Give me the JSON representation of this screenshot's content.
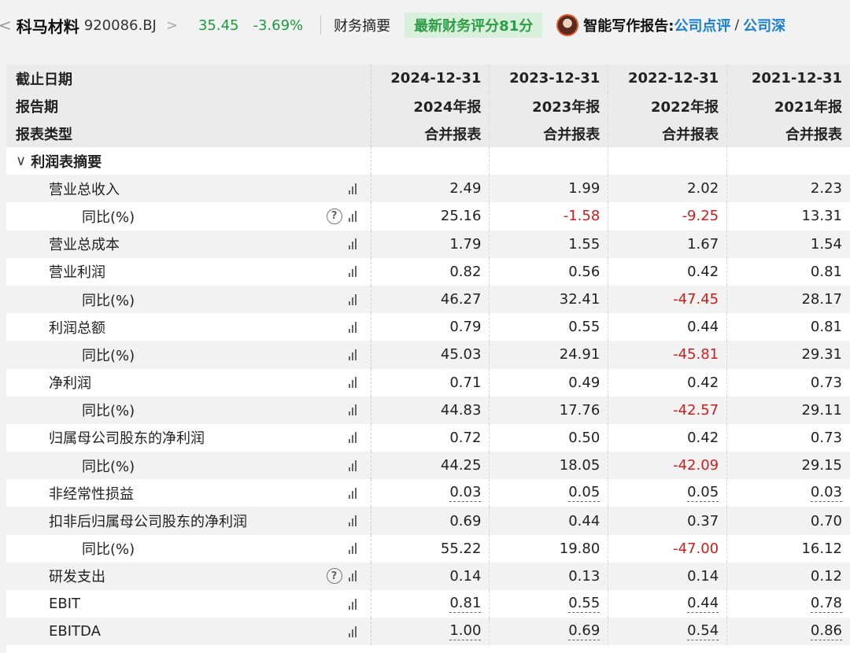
{
  "header": {
    "back_glyph": "<",
    "stock_name": "科马材料",
    "stock_code": "920086.BJ",
    "code_chevron": ">",
    "price": "35.45",
    "change_pct": "-3.69%",
    "section_label": "财务摘要",
    "score_badge": "最新财务评分81分",
    "ai_report_label": "智能写作报告:",
    "ai_link_1": "公司点评",
    "ai_slash": "/",
    "ai_link_2": "公司深",
    "price_color": "#1e9a3c",
    "link_color": "#1a7fd4"
  },
  "table": {
    "header_rows": [
      {
        "label": "截止日期",
        "values": [
          "2024-12-31",
          "2023-12-31",
          "2022-12-31",
          "2021-12-31"
        ]
      },
      {
        "label": "报告期",
        "values": [
          "2024年报",
          "2023年报",
          "2022年报",
          "2021年报"
        ]
      },
      {
        "label": "报表类型",
        "values": [
          "合并报表",
          "合并报表",
          "合并报表",
          "合并报表"
        ]
      }
    ],
    "section": {
      "chevron": "∨",
      "label": "利润表摘要"
    },
    "rows": [
      {
        "label": "营业总收入",
        "values": [
          "2.49",
          "1.99",
          "2.02",
          "2.23"
        ]
      },
      {
        "label": "同比(%)",
        "values": [
          "25.16",
          "-1.58",
          "-9.25",
          "13.31"
        ]
      },
      {
        "label": "营业总成本",
        "values": [
          "1.79",
          "1.55",
          "1.67",
          "1.54"
        ]
      },
      {
        "label": "营业利润",
        "values": [
          "0.82",
          "0.56",
          "0.42",
          "0.81"
        ]
      },
      {
        "label": "同比(%)",
        "values": [
          "46.27",
          "32.41",
          "-47.45",
          "28.17"
        ]
      },
      {
        "label": "利润总额",
        "values": [
          "0.79",
          "0.55",
          "0.44",
          "0.81"
        ]
      },
      {
        "label": "同比(%)",
        "values": [
          "45.03",
          "24.91",
          "-45.81",
          "29.31"
        ]
      },
      {
        "label": "净利润",
        "values": [
          "0.71",
          "0.49",
          "0.42",
          "0.73"
        ]
      },
      {
        "label": "同比(%)",
        "values": [
          "44.83",
          "17.76",
          "-42.57",
          "29.11"
        ]
      },
      {
        "label": "归属母公司股东的净利润",
        "values": [
          "0.72",
          "0.50",
          "0.42",
          "0.73"
        ]
      },
      {
        "label": "同比(%)",
        "values": [
          "44.25",
          "18.05",
          "-42.09",
          "29.15"
        ]
      },
      {
        "label": "非经常性损益",
        "values": [
          "0.03",
          "0.05",
          "0.05",
          "0.03"
        ]
      },
      {
        "label": "扣非后归属母公司股东的净利润",
        "values": [
          "0.69",
          "0.44",
          "0.37",
          "0.70"
        ]
      },
      {
        "label": "同比(%)",
        "values": [
          "55.22",
          "19.80",
          "-47.00",
          "16.12"
        ]
      },
      {
        "label": "研发支出",
        "values": [
          "0.14",
          "0.13",
          "0.14",
          "0.12"
        ]
      },
      {
        "label": "EBIT",
        "values": [
          "0.81",
          "0.55",
          "0.44",
          "0.78"
        ]
      },
      {
        "label": "EBITDA",
        "values": [
          "1.00",
          "0.69",
          "0.54",
          "0.86"
        ]
      }
    ],
    "help_glyph": "?",
    "negative_color": "#d21c1c"
  }
}
